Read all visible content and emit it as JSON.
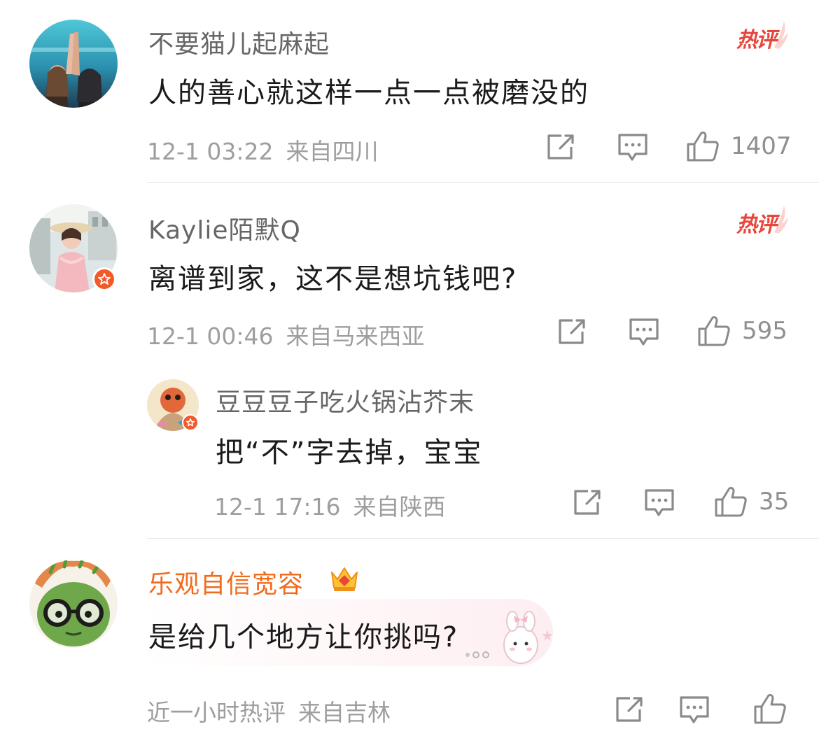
{
  "comments": [
    {
      "username": "不要猫儿起麻起",
      "text": "人的善心就这样一点一点被磨没的",
      "time": "12-1 03:22",
      "location": "来自四川",
      "likes": "1407",
      "hot_label": "热评"
    },
    {
      "username": "Kaylie陌默Q",
      "text": "离谱到家，这不是想坑钱吧?",
      "time": "12-1 00:46",
      "location": "来自马来西亚",
      "likes": "595",
      "hot_label": "热评",
      "reply": {
        "username": "豆豆豆子吃火锅沾芥末",
        "text": "把“不”字去掉，宝宝",
        "time": "12-1 17:16",
        "location": "来自陕西",
        "likes": "35"
      }
    },
    {
      "username": "乐观自信宽容",
      "text": "是给几个地方让你挑吗?",
      "time": "近一小时热评",
      "location": "来自吉林"
    }
  ],
  "colors": {
    "vip_name": "#f26b1d",
    "hot_label": "#e8463a",
    "meta_text": "#9e9e9e",
    "badge": "#f25a2a"
  },
  "icons": [
    "share-icon",
    "comment-icon",
    "like-icon",
    "verified-badge-icon",
    "crown-icon",
    "hot-comment-icon"
  ]
}
